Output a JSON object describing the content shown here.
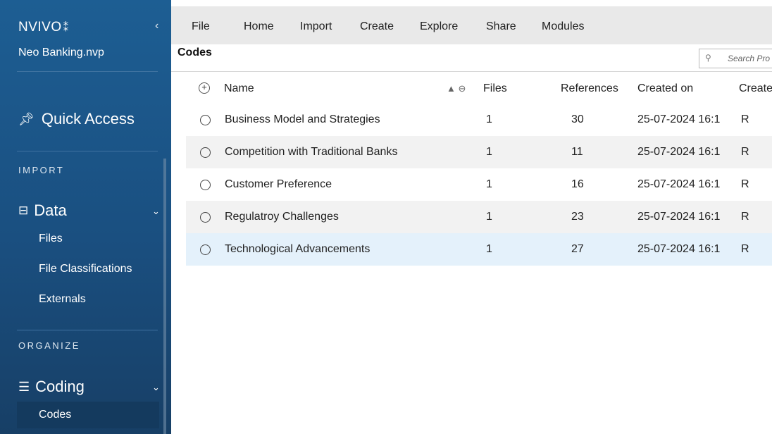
{
  "app": {
    "logo": "NVIVO",
    "logo_mark": "⁑",
    "project": "Neo Banking.nvp"
  },
  "sidebar": {
    "quick_access": "Quick Access",
    "sections": {
      "import": "IMPORT",
      "organize": "ORGANIZE"
    },
    "data_group": {
      "label": "Data",
      "items": [
        "Files",
        "File Classifications",
        "Externals"
      ]
    },
    "coding_group": {
      "label": "Coding",
      "items": [
        "Codes"
      ]
    }
  },
  "menu": [
    "File",
    "Home",
    "Import",
    "Create",
    "Explore",
    "Share",
    "Modules"
  ],
  "view": {
    "title": "Codes",
    "search_placeholder": "Search Pro"
  },
  "table": {
    "headers": {
      "name": "Name",
      "files": "Files",
      "references": "References",
      "created_on": "Created on",
      "created_by": "Create"
    },
    "rows": [
      {
        "name": "Business Model and Strategies",
        "files": "1",
        "references": "30",
        "created_on": "25-07-2024 16:1",
        "created_by": "R"
      },
      {
        "name": "Competition with Traditional Banks",
        "files": "1",
        "references": "11",
        "created_on": "25-07-2024 16:1",
        "created_by": "R"
      },
      {
        "name": "Customer Preference",
        "files": "1",
        "references": "16",
        "created_on": "25-07-2024 16:1",
        "created_by": "R"
      },
      {
        "name": "Regulatroy Challenges",
        "files": "1",
        "references": "23",
        "created_on": "25-07-2024 16:1",
        "created_by": "R"
      },
      {
        "name": "Technological Advancements",
        "files": "1",
        "references": "27",
        "created_on": "25-07-2024 16:1",
        "created_by": "R"
      }
    ]
  },
  "colors": {
    "sidebar": "#1d5e93",
    "selected_row": "#e4f1fb",
    "alt_row": "#f2f2f2",
    "toolbar": "#e9e9e9"
  }
}
